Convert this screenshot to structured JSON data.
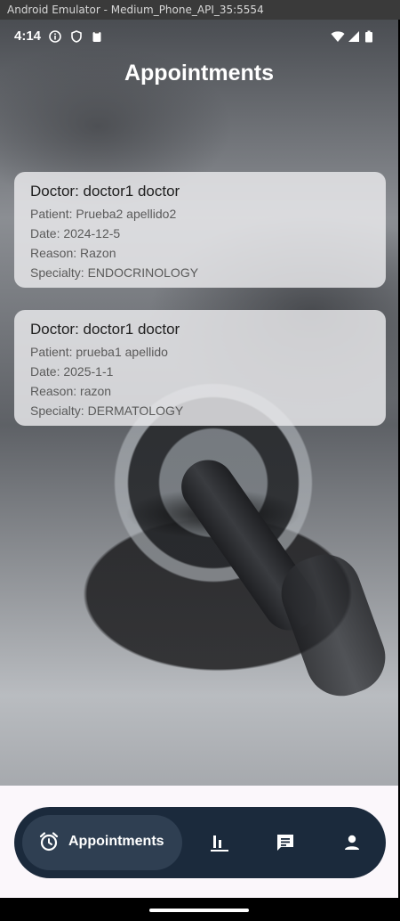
{
  "window": {
    "title": "Android Emulator - Medium_Phone_API_35:5554"
  },
  "status_bar": {
    "time": "4:14",
    "left_icons": [
      "info-icon",
      "shield-icon",
      "clipboard-icon"
    ],
    "right_icons": [
      "wifi-icon",
      "signal-icon",
      "battery-icon"
    ]
  },
  "header": {
    "title": "Appointments"
  },
  "appointments": [
    {
      "doctor": "Doctor: doctor1 doctor",
      "patient": "Patient: Prueba2 apellido2",
      "date": "Date: 2024-12-5",
      "reason": "Reason: Razon",
      "specialty": "Specialty: ENDOCRINOLOGY"
    },
    {
      "doctor": "Doctor: doctor1 doctor",
      "patient": "Patient: prueba1 apellido",
      "date": "Date: 2025-1-1",
      "reason": "Reason: razon",
      "specialty": "Specialty: DERMATOLOGY"
    }
  ],
  "bottom_nav": {
    "items": [
      {
        "label": "Appointments",
        "icon": "alarm-clock-icon",
        "active": true
      },
      {
        "label": "",
        "icon": "bar-chart-icon",
        "active": false
      },
      {
        "label": "",
        "icon": "message-icon",
        "active": false
      },
      {
        "label": "",
        "icon": "person-icon",
        "active": false
      }
    ]
  },
  "colors": {
    "nav_background": "#1b2a3c",
    "nav_active": "#2f3f52",
    "card_background": "#ebeced"
  }
}
